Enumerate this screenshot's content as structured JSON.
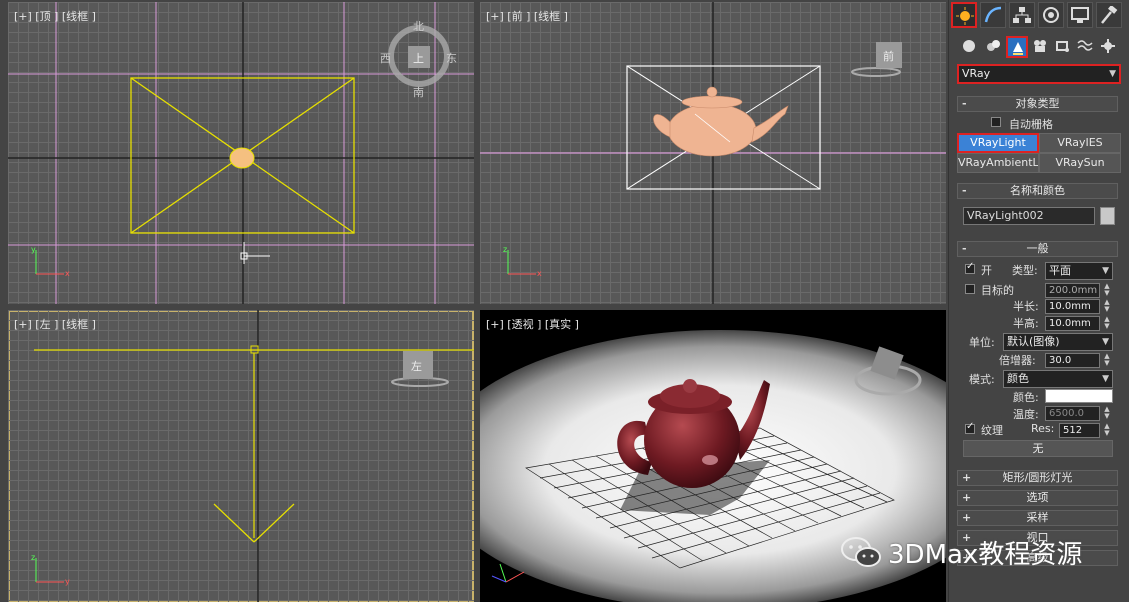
{
  "viewports": {
    "top": {
      "label": "[+] [顶 ] [线框 ]",
      "viewcube": {
        "n": "北",
        "s": "南",
        "w": "西",
        "e": "东",
        "face": "上"
      }
    },
    "front": {
      "label": "[+] [前 ] [线框 ]",
      "viewcube_face": "前"
    },
    "left": {
      "label": "[+] [左 ] [线框 ]",
      "viewcube_face": "左"
    },
    "perspective": {
      "label": "[+] [透视 ] [真实 ]"
    }
  },
  "panel": {
    "tabs": [
      {
        "name": "create-tab",
        "icon": "sun-icon",
        "active": true
      },
      {
        "name": "modify-tab",
        "icon": "arc-icon"
      },
      {
        "name": "hierarchy-tab",
        "icon": "hierarchy-icon"
      },
      {
        "name": "motion-tab",
        "icon": "motion-icon"
      },
      {
        "name": "display-tab",
        "icon": "display-icon"
      },
      {
        "name": "utilities-tab",
        "icon": "hammer-icon"
      }
    ],
    "category_select": "VRay",
    "object_type": {
      "title": "对象类型",
      "toggle": "-",
      "autogrid": "自动栅格",
      "buttons": [
        "VRayLight",
        "VRayIES",
        "VRayAmbientLight",
        "VRaySun"
      ]
    },
    "name_color": {
      "title": "名称和颜色",
      "toggle": "-",
      "name_value": "VRayLight002",
      "color": "#c8c8c8"
    },
    "general": {
      "title": "一般",
      "toggle": "-",
      "on_label": "开",
      "type_label": "类型:",
      "type_value": "平面",
      "targeted_label": "目标的",
      "targeted_value": "200.0mm",
      "half_length_label": "半长:",
      "half_length_value": "10.0mm",
      "half_width_label": "半高:",
      "half_width_value": "10.0mm",
      "units_label": "单位:",
      "units_value": "默认(图像)",
      "multiplier_label": "倍增器:",
      "multiplier_value": "30.0",
      "mode_label": "模式:",
      "mode_value": "颜色",
      "color_label": "颜色:",
      "color_value": "#ffffff",
      "temperature_label": "温度:",
      "temperature_value": "6500.0",
      "texture_label": "纹理",
      "res_label": "Res:",
      "res_value": "512",
      "none_button": "无"
    },
    "rollouts": [
      {
        "sym": "+",
        "label": "矩形/圆形灯光"
      },
      {
        "sym": "+",
        "label": "选项"
      },
      {
        "sym": "+",
        "label": "采样"
      },
      {
        "sym": "+",
        "label": "视口"
      },
      {
        "sym": "+",
        "label": "高级"
      }
    ]
  },
  "watermark": {
    "text": "3DMax教程资源"
  }
}
